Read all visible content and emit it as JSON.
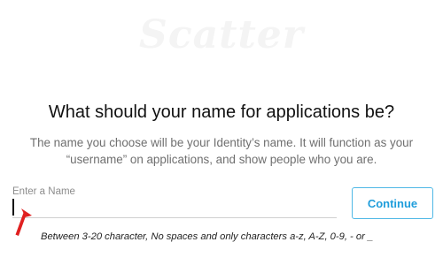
{
  "logo": {
    "text": "Scatter"
  },
  "title": "What should your name for applications be?",
  "description": "The name you choose will be your Identity’s name. It will function as your “username” on applications, and show people who you are.",
  "name_field": {
    "label": "Enter a Name",
    "value": "",
    "placeholder": ""
  },
  "continue_button": {
    "label": "Continue"
  },
  "hint": "Between 3-20 character, No spaces and only characters a-z, A-Z, 0-9, - or _",
  "colors": {
    "accent": "#1f9ddb",
    "annotation_arrow": "#e02020"
  }
}
